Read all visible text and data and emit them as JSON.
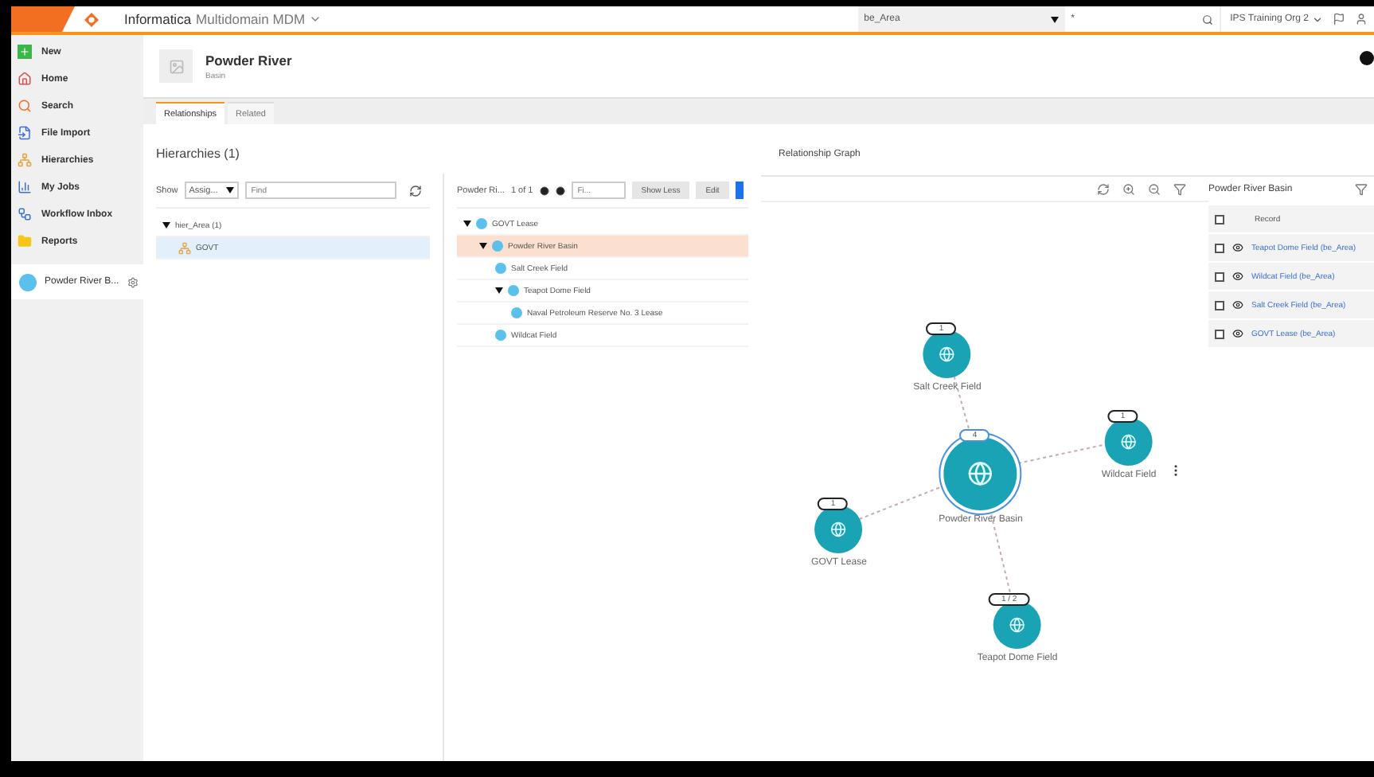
{
  "topbar": {
    "brand": "Informatica",
    "app": "Multidomain MDM",
    "entity_select": "be_Area",
    "search_value": "*",
    "org": "IPS Training Org 2"
  },
  "sidebar": {
    "items": [
      {
        "label": "New",
        "kind": "new"
      },
      {
        "label": "Home",
        "kind": "home"
      },
      {
        "label": "Search",
        "kind": "search"
      },
      {
        "label": "File Import",
        "kind": "import"
      },
      {
        "label": "Hierarchies",
        "kind": "hierarchy"
      },
      {
        "label": "My Jobs",
        "kind": "jobs"
      },
      {
        "label": "Workflow Inbox",
        "kind": "workflow"
      },
      {
        "label": "Reports",
        "kind": "reports"
      }
    ],
    "recent": [
      {
        "label": "Powder River B..."
      }
    ]
  },
  "header": {
    "title": "Powder River",
    "subtitle": "Basin"
  },
  "tabs": [
    {
      "label": "Relationships",
      "selected": true
    },
    {
      "label": "Related",
      "selected": false
    }
  ],
  "hierarchies": {
    "title": "Hierarchies (1)",
    "show_label": "Show",
    "show_select": "Assig...",
    "find_placeholder": "Find",
    "tree": [
      {
        "label": "hier_Area (1)",
        "expanded": true,
        "selected": false,
        "children": [
          {
            "label": "GOVT",
            "selected": true
          }
        ]
      }
    ]
  },
  "detail": {
    "name": "Powder Ri...",
    "count": "1 of 1",
    "filter_placeholder": "Fi...",
    "buttons": [
      "Show Less",
      "Edit"
    ],
    "tree": [
      {
        "label": "GOVT Lease",
        "expanded": true,
        "selected": false,
        "children": [
          {
            "label": "Powder River Basin",
            "expanded": true,
            "selected": true,
            "children": [
              {
                "label": "Salt Creek Field",
                "selected": false
              },
              {
                "label": "Teapot Dome Field",
                "expanded": true,
                "selected": false,
                "children": [
                  {
                    "label": "Naval Petroleum Reserve No. 3 Lease",
                    "selected": false
                  }
                ]
              },
              {
                "label": "Wildcat Field",
                "selected": false
              }
            ]
          }
        ]
      }
    ]
  },
  "graph": {
    "title": "Relationship Graph",
    "nodes": [
      {
        "label": "Salt Creek Field",
        "badge": "1",
        "kind": "related"
      },
      {
        "label": "Powder River Basin",
        "badge": "4",
        "kind": "focus"
      },
      {
        "label": "Wildcat Field",
        "badge": "1",
        "kind": "related"
      },
      {
        "label": "GOVT Lease",
        "badge": "1",
        "kind": "related"
      },
      {
        "label": "Teapot Dome Field",
        "badge": "1 / 2",
        "kind": "related"
      }
    ]
  },
  "records": {
    "title": "Powder River Basin",
    "column": "Record",
    "header_checked": false,
    "rows": [
      {
        "label": "Teapot Dome Field (be_Area)",
        "checked": false
      },
      {
        "label": "Wildcat Field (be_Area)",
        "checked": false
      },
      {
        "label": "Salt Creek Field (be_Area)",
        "checked": false
      },
      {
        "label": "GOVT Lease (be_Area)",
        "checked": false
      }
    ]
  }
}
